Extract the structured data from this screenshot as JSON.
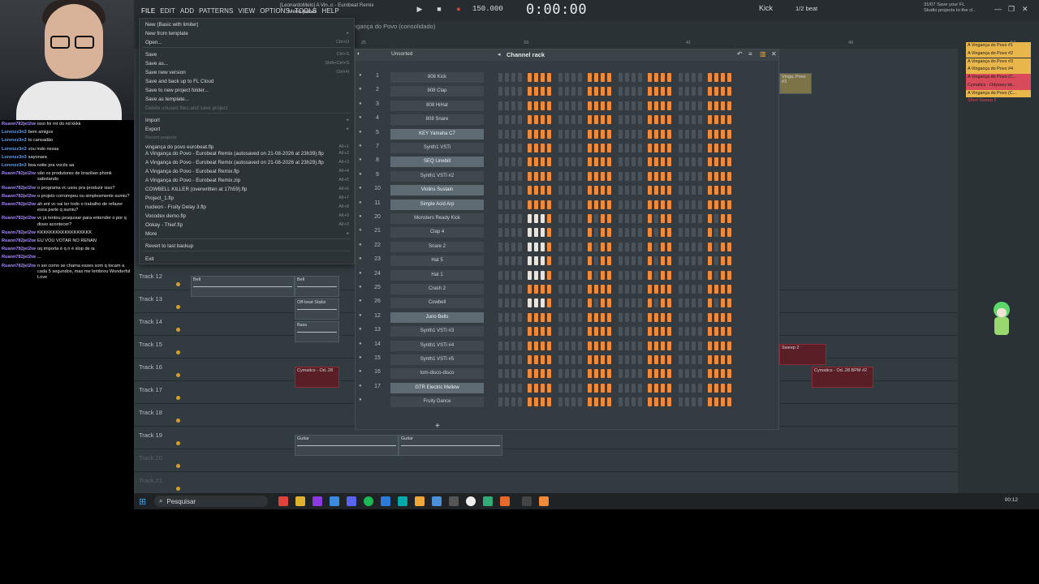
{
  "menubar": [
    "FILE",
    "EDIT",
    "ADD",
    "PATTERNS",
    "VIEW",
    "OPTIONS",
    "TOOLS",
    "HELP"
  ],
  "project_title": "[LeonardoMelo] A Vin..o - Eurobeat Remix",
  "menu_panel": "Menu panel",
  "transport": {
    "tempo": "150.000",
    "time": "0:00:00",
    "pattern": "Kick",
    "snap": "1/2 beat"
  },
  "hint": {
    "line1": "31/07  Save your FL",
    "line2": "Studio projects to the cl.."
  },
  "playlist_title": "ngança do Povo (consolidado)",
  "ruler": [
    "25",
    "33",
    "41",
    "49",
    "57"
  ],
  "file_menu": {
    "items": [
      {
        "label": "New (Basic with limiter)",
        "sc": ""
      },
      {
        "label": "New from template",
        "sc": "▸"
      },
      {
        "label": "Open...",
        "sc": "Ctrl+O"
      },
      {
        "label": "Save",
        "sc": "Ctrl+S"
      },
      {
        "label": "Save as...",
        "sc": "Shift+Ctrl+S"
      },
      {
        "label": "Save new version",
        "sc": "Ctrl+N"
      },
      {
        "label": "Save and back up to FL Cloud",
        "sc": ""
      },
      {
        "label": "Save to new project folder...",
        "sc": ""
      },
      {
        "label": "Save as template...",
        "sc": ""
      },
      {
        "label": "Delete unused files and save project",
        "sc": ""
      },
      {
        "label": "Import",
        "sc": "▸"
      },
      {
        "label": "Export",
        "sc": "▸"
      },
      {
        "label": "Recent projects",
        "sc": ""
      },
      {
        "label": "vingança do povo eurobeat.flp",
        "sc": "Alt+1"
      },
      {
        "label": "A Vingança do Povo - Eurobeat Remix (autosaved on 21-08-2026 at 23h39).flp",
        "sc": "Alt+2"
      },
      {
        "label": "A Vingança do Povo - Eurobeat Remix (autosaved on 21-08-2026 at 23h29).flp",
        "sc": "Alt+3"
      },
      {
        "label": "A Vingança do Povo - Eurobeat Remix.flp",
        "sc": "Alt+4"
      },
      {
        "label": "A Vingança do Povo - Eurobeat Remix.zip",
        "sc": "Alt+5"
      },
      {
        "label": "COWBELL KILLER (overwritten at 17h59).flp",
        "sc": "Alt+6"
      },
      {
        "label": "Project_1.flp",
        "sc": "Alt+7"
      },
      {
        "label": "nucleon - Fruity Delay 3.flp",
        "sc": "Alt+8"
      },
      {
        "label": "Vocodex demo.flp",
        "sc": "Alt+9"
      },
      {
        "label": "Ookay - Thief.flp",
        "sc": "Alt+0"
      },
      {
        "label": "More",
        "sc": "▸"
      },
      {
        "label": "Revert to last backup",
        "sc": ""
      },
      {
        "label": "Exit",
        "sc": ""
      }
    ]
  },
  "chat": [
    {
      "user": "Ruann782jel2iw",
      "msg": "isso foi mt do nd kkkk"
    },
    {
      "user": "Lorenzz3n3",
      "msg": "bem amigos"
    },
    {
      "user": "Lorenzz3n3",
      "msg": "to cansadão"
    },
    {
      "user": "Lorenzz3n3",
      "msg": "vou indo nessa"
    },
    {
      "user": "Lorenzz3n3",
      "msg": "sayonara"
    },
    {
      "user": "Lorenzz3n3",
      "msg": "boa noite pra vocês aa"
    },
    {
      "user": "Ruann782jel2iw",
      "msg": "são os produtores de brazilian phonk sabotando"
    },
    {
      "user": "Ruann782jel2iw",
      "msg": "o programa vc usou pra produzir isso?"
    },
    {
      "user": "Ruann782jel2iw",
      "msg": "o projeto corrompeu ou simplesmente sumiu?"
    },
    {
      "user": "Ruann782jel2iw",
      "msg": "ah ent vc vai ter todo o trabalho de refazer essa parte q sumiu?"
    },
    {
      "user": "Ruann782jel2iw",
      "msg": "vc já tentou pesquisar para entender o por q disso acontecer?"
    },
    {
      "user": "Ruann782jel2iw",
      "msg": "KKKKKKKKKKKKKKKKKK"
    },
    {
      "user": "Ruann782jel2iw",
      "msg": "EU VOU VOTAR NO RENAN"
    },
    {
      "user": "Ruann782jel2iw",
      "msg": "oq importa é q n é slop de ia"
    },
    {
      "user": "Ruann782jel2iw",
      "msg": "..."
    },
    {
      "user": "Ruann782jel2iw",
      "msg": "n sei como se chama esses som q tocam a cada 5 segundos, mas me lembrou Wonderful Love"
    }
  ],
  "tracks": [
    {
      "label": "Track 12",
      "dim": false
    },
    {
      "label": "Track 13",
      "dim": false
    },
    {
      "label": "Track 14",
      "dim": false
    },
    {
      "label": "Track 15",
      "dim": false
    },
    {
      "label": "Track 16",
      "dim": false
    },
    {
      "label": "Track 17",
      "dim": false
    },
    {
      "label": "Track 18",
      "dim": false
    },
    {
      "label": "Track 19",
      "dim": false
    },
    {
      "label": "Track 20",
      "dim": true
    },
    {
      "label": "Track 21",
      "dim": true
    }
  ],
  "clips": {
    "bell1": "Bell",
    "bell2": "Bell",
    "offbeat": "Off-beat Stabs",
    "bass": "Bass",
    "cym1": "Cymatics - Od..28",
    "cym2": "Cymatics - Od..28 BPM #2",
    "sweep": "Sweep 2",
    "guitar1": "Guitar",
    "guitar2": "Guitar",
    "povo": "Vinga. Povo #3"
  },
  "rack": {
    "filter": "Unsorted",
    "title": "Channel rack",
    "channels": [
      {
        "num": "1",
        "name": "808 Kick",
        "hl": false,
        "pat": "k"
      },
      {
        "num": "2",
        "name": "808 Clap",
        "hl": false,
        "pat": "k"
      },
      {
        "num": "3",
        "name": "808 HiHat",
        "hl": false,
        "pat": "k"
      },
      {
        "num": "4",
        "name": "808 Snare",
        "hl": false,
        "pat": "k"
      },
      {
        "num": "5",
        "name": "KEY Yamaha C7",
        "hl": true,
        "pat": "k"
      },
      {
        "num": "7",
        "name": "Synth1 VSTi",
        "hl": false,
        "pat": "k"
      },
      {
        "num": "8",
        "name": "SEQ Linebill",
        "hl": true,
        "pat": "k"
      },
      {
        "num": "9",
        "name": "Synth1 VSTi #2",
        "hl": false,
        "pat": "k"
      },
      {
        "num": "10",
        "name": "Violins Sustain",
        "hl": true,
        "pat": "k"
      },
      {
        "num": "11",
        "name": "Simple Acid Arp",
        "hl": true,
        "pat": "k"
      },
      {
        "num": "20",
        "name": "Monsters Ready Kick",
        "hl": false,
        "pat": "w"
      },
      {
        "num": "21",
        "name": "Clap 4",
        "hl": false,
        "pat": "w"
      },
      {
        "num": "22",
        "name": "Snare 2",
        "hl": false,
        "pat": "w"
      },
      {
        "num": "23",
        "name": "Hat 5",
        "hl": false,
        "pat": "w"
      },
      {
        "num": "24",
        "name": "Hat 1",
        "hl": false,
        "pat": "w"
      },
      {
        "num": "25",
        "name": "Crash 2",
        "hl": false,
        "pat": "k"
      },
      {
        "num": "26",
        "name": "Cowbell",
        "hl": false,
        "pat": "w"
      },
      {
        "num": "12",
        "name": "Juno Bells",
        "hl": true,
        "pat": "k"
      },
      {
        "num": "13",
        "name": "Synth1 VSTi #3",
        "hl": false,
        "pat": "k"
      },
      {
        "num": "14",
        "name": "Synth1 VSTi #4",
        "hl": false,
        "pat": "k"
      },
      {
        "num": "15",
        "name": "Synth1 VSTi #5",
        "hl": false,
        "pat": "k"
      },
      {
        "num": "16",
        "name": "tom-disco-disco",
        "hl": false,
        "pat": "k"
      },
      {
        "num": "17",
        "name": "GTR Electric Mellow",
        "hl": true,
        "pat": "k"
      },
      {
        "num": "",
        "name": "Fruity Dance",
        "hl": false,
        "pat": "k"
      }
    ]
  },
  "patterns": [
    {
      "label": "A Vingança do Povo #1",
      "color": "#e8b64a"
    },
    {
      "label": "A Vingança do Povo #2",
      "color": "#e8b64a"
    },
    {
      "label": "A Vingança do Povo #3",
      "color": "#e8b64a"
    },
    {
      "label": "A Vingança do Povo #4",
      "color": "#e8b64a"
    },
    {
      "label": "A Vingança do Povo (C...",
      "color": "#d94a5a"
    },
    {
      "label": "Cymatics - Odyssey kit...",
      "color": "#d94a5a"
    },
    {
      "label": "A Vingança do Povo (C...",
      "color": "#e8b64a"
    },
    {
      "label": "Short Sweep 2",
      "color": "#d94a5a"
    }
  ],
  "taskbar": {
    "search": "Pesquisar",
    "time": "00:12"
  }
}
